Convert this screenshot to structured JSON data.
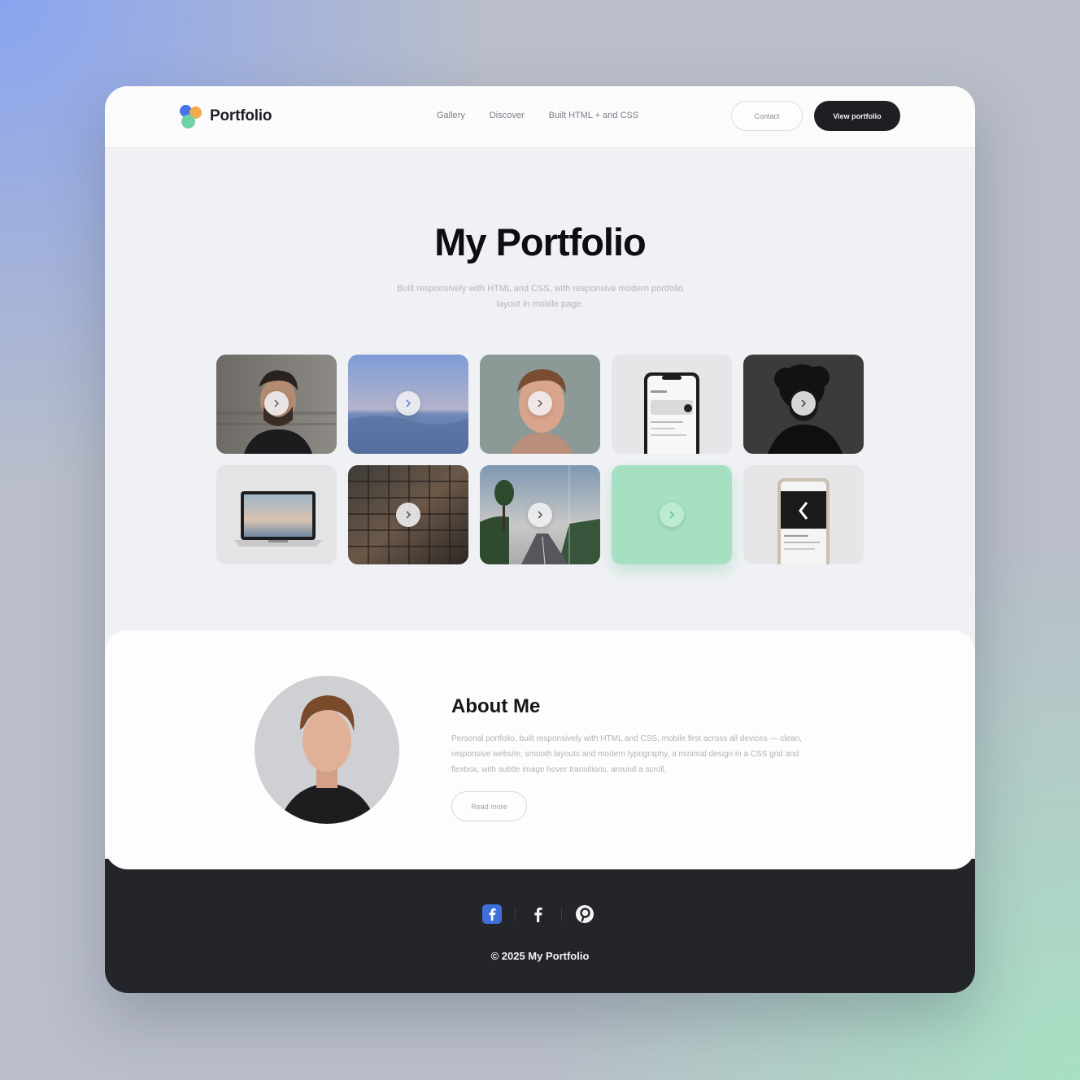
{
  "header": {
    "brand": "Portfolio",
    "nav": [
      "Gallery",
      "Discover",
      "Built HTML + and CSS"
    ],
    "ghost_button": "Contact",
    "primary_button": "View portfolio"
  },
  "hero": {
    "title": "My Portfolio",
    "subtitle": "Built responsively with HTML and CSS, with responsive modern portfolio layout in mobile page."
  },
  "gallery": {
    "tiles": [
      {
        "name": "portrait-man-beard",
        "icon": "play-icon"
      },
      {
        "name": "ocean-horizon",
        "icon": "play-icon"
      },
      {
        "name": "portrait-young-man",
        "icon": "play-icon"
      },
      {
        "name": "phone-mockup-light",
        "icon": "none"
      },
      {
        "name": "silhouette-curly-hair",
        "icon": "play-icon"
      },
      {
        "name": "laptop-mockup",
        "icon": "none"
      },
      {
        "name": "grid-overlay-photo",
        "icon": "play-icon"
      },
      {
        "name": "forest-road",
        "icon": "play-icon"
      },
      {
        "name": "mint-color-tile",
        "icon": "play-icon"
      },
      {
        "name": "phone-mockup-dark",
        "icon": "back-chevron-icon"
      }
    ]
  },
  "about": {
    "title": "About Me",
    "text": "Personal portfolio, built responsively with HTML and CSS, mobile first across all devices — clean, responsive website, smooth layouts and modern typography, a minimal design in a CSS grid and flexbox, with subtle image hover transitions, around a scroll.",
    "button": "Read more"
  },
  "footer": {
    "socials": [
      "facebook-square-icon",
      "facebook-icon",
      "pinterest-icon"
    ],
    "copyright": "© 2025 My Portfolio"
  },
  "colors": {
    "accent": "#4a73e8",
    "dark": "#1e1f22",
    "footer": "#23252a",
    "mint": "#a5e0c3"
  }
}
